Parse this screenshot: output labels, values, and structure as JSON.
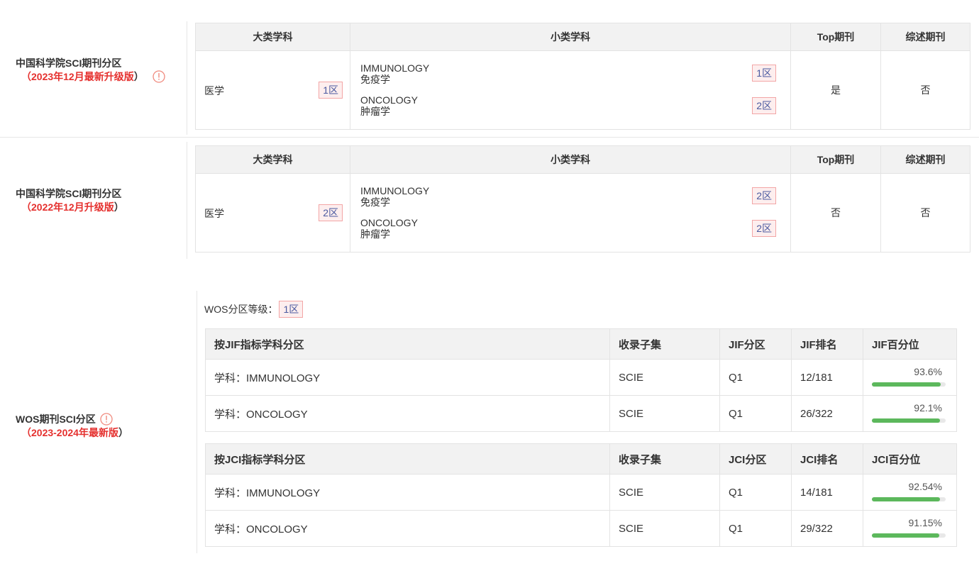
{
  "cas2023": {
    "label_line1": "中国科学院SCI期刊分区",
    "label_paren_open": "（",
    "label_red": "2023年12月最新升级版",
    "label_paren_close": "）",
    "headers": [
      "大类学科",
      "小类学科",
      "Top期刊",
      "综述期刊"
    ],
    "big_subject": "医学",
    "big_zone": "1区",
    "subjects": [
      {
        "en": "IMMUNOLOGY",
        "zh": "免疫学",
        "zone": "1区"
      },
      {
        "en": "ONCOLOGY",
        "zh": "肿瘤学",
        "zone": "2区"
      }
    ],
    "top": "是",
    "review": "否"
  },
  "cas2022": {
    "label_line1": "中国科学院SCI期刊分区",
    "label_paren_open": "（",
    "label_red": "2022年12月升级版",
    "label_paren_close": "）",
    "headers": [
      "大类学科",
      "小类学科",
      "Top期刊",
      "综述期刊"
    ],
    "big_subject": "医学",
    "big_zone": "2区",
    "subjects": [
      {
        "en": "IMMUNOLOGY",
        "zh": "免疫学",
        "zone": "2区"
      },
      {
        "en": "ONCOLOGY",
        "zh": "肿瘤学",
        "zone": "2区"
      }
    ],
    "top": "否",
    "review": "否"
  },
  "wos": {
    "label_line1": "WOS期刊SCI分区",
    "label_paren_open": "（",
    "label_red": "2023-2024年最新版",
    "label_paren_close": "）",
    "level_label": "WOS分区等级：",
    "level_zone": "1区",
    "jif": {
      "headers": [
        "按JIF指标学科分区",
        "收录子集",
        "JIF分区",
        "JIF排名",
        "JIF百分位"
      ],
      "rows": [
        {
          "subject": "学科：IMMUNOLOGY",
          "set": "SCIE",
          "q": "Q1",
          "rank": "12/181",
          "pct": "93.6%",
          "pct_value": 93.6
        },
        {
          "subject": "学科：ONCOLOGY",
          "set": "SCIE",
          "q": "Q1",
          "rank": "26/322",
          "pct": "92.1%",
          "pct_value": 92.1
        }
      ]
    },
    "jci": {
      "headers": [
        "按JCI指标学科分区",
        "收录子集",
        "JCI分区",
        "JCI排名",
        "JCI百分位"
      ],
      "rows": [
        {
          "subject": "学科：IMMUNOLOGY",
          "set": "SCIE",
          "q": "Q1",
          "rank": "14/181",
          "pct": "92.54%",
          "pct_value": 92.54
        },
        {
          "subject": "学科：ONCOLOGY",
          "set": "SCIE",
          "q": "Q1",
          "rank": "29/322",
          "pct": "91.15%",
          "pct_value": 91.15
        }
      ]
    }
  },
  "colors": {
    "accent_red": "#e5302e",
    "zone_text": "#4a5aa0",
    "bar_green": "#5cb85c"
  }
}
